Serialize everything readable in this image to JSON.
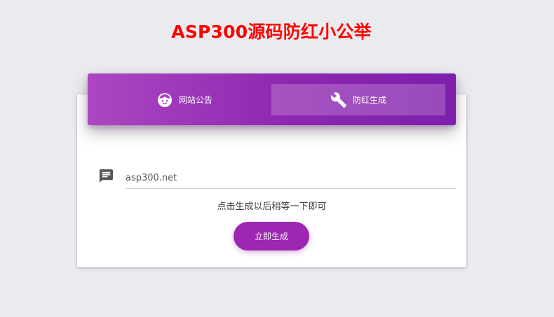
{
  "page": {
    "title": "ASP300源码防红小公举",
    "title_color": "#ff0000",
    "background": "#eaebef"
  },
  "tabs": [
    {
      "label": "网站公告",
      "icon": "face-icon",
      "active": false
    },
    {
      "label": "防红生成",
      "icon": "wrench-icon",
      "active": true
    }
  ],
  "tab_bar": {
    "gradient_start": "#ac46c1",
    "gradient_end": "#7d1fab"
  },
  "form": {
    "field_icon": "chat-message-icon",
    "domain_value": "asp300.net",
    "hint": "点击生成以后稍等一下即可",
    "submit_label": "立即生成",
    "submit_color": "#9c27b0"
  }
}
